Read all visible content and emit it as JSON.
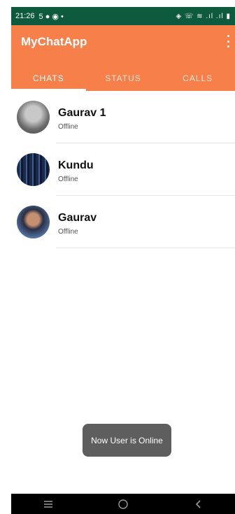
{
  "status_bar": {
    "time": "21:26",
    "left_icons": "5 ● ◉ •",
    "right_icons": "◈ ☏ ≋ .ıl .ıl ▮"
  },
  "app": {
    "title": "MyChatApp",
    "accent_color": "#f7804a",
    "status_bar_color": "#0d5a3f"
  },
  "tabs": [
    {
      "label": "CHATS",
      "active": true
    },
    {
      "label": "STATUS",
      "active": false
    },
    {
      "label": "CALLS",
      "active": false
    }
  ],
  "chats": [
    {
      "name": "Gaurav 1",
      "status": "Offline",
      "avatar_icon": "user-avatar-icon"
    },
    {
      "name": "Kundu",
      "status": "Offline",
      "avatar_icon": "user-avatar-icon"
    },
    {
      "name": "Gaurav",
      "status": "Offline",
      "avatar_icon": "user-avatar-icon"
    }
  ],
  "toast": {
    "message": "Now User is Online"
  },
  "nav_bar": {
    "recents_icon": "menu-icon",
    "home_icon": "home-circle-icon",
    "back_icon": "back-chevron-icon"
  }
}
